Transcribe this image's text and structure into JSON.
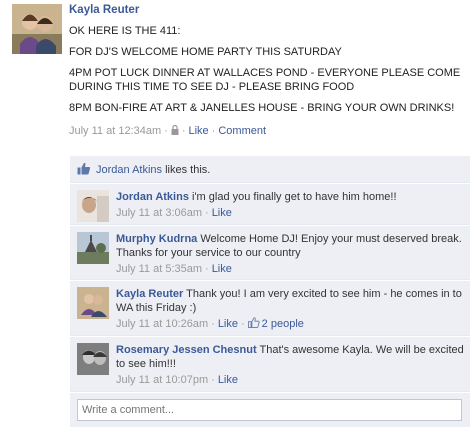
{
  "post": {
    "author": "Kayla Reuter",
    "paragraphs": [
      "OK HERE IS THE 411:",
      "FOR DJ'S WELCOME HOME PARTY THIS SATURDAY",
      "4PM POT LUCK DINNER AT WALLACES POND - EVERYONE PLEASE COME DURING THIS TIME TO SEE DJ - PLEASE BRING FOOD",
      "8PM BON-FIRE AT ART & JANELLES HOUSE - BRING YOUR OWN DRINKS!"
    ],
    "timestamp": "July 11 at 12:34am",
    "separator": "·",
    "like_label": "Like",
    "comment_label": "Comment"
  },
  "likes": {
    "liker": "Jordan Atkins",
    "text": "likes this."
  },
  "comments": [
    {
      "author": "Jordan Atkins",
      "text": "i'm glad you finally get to have him home!!",
      "timestamp": "July 11 at 3:06am",
      "like_label": "Like",
      "like_count": ""
    },
    {
      "author": "Murphy Kudrna",
      "text": "Welcome Home DJ! Enjoy your must deserved break. Thanks for your service to our country",
      "timestamp": "July 11 at 5:35am",
      "like_label": "Like",
      "like_count": ""
    },
    {
      "author": "Kayla Reuter",
      "text": "Thank you! I am very excited to see him - he comes in to WA this Friday :)",
      "timestamp": "July 11 at 10:26am",
      "like_label": "Like",
      "like_count": "2 people"
    },
    {
      "author": "Rosemary Jessen Chesnut",
      "text": "That's awesome Kayla. We will be excited to see him!!!",
      "timestamp": "July 11 at 10:07pm",
      "like_label": "Like",
      "like_count": ""
    }
  ],
  "write_comment": {
    "placeholder": "Write a comment..."
  },
  "colors": {
    "link": "#3b5998",
    "ufi_background": "#edeff4",
    "muted": "#999999"
  }
}
